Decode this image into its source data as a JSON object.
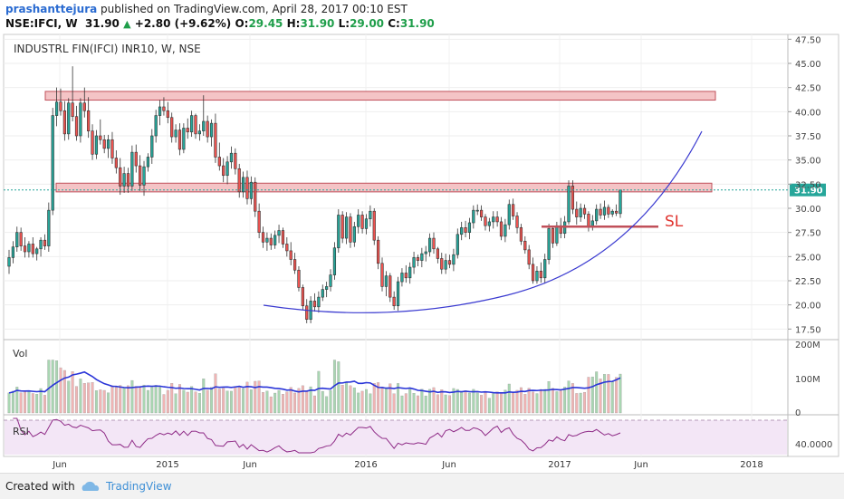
{
  "header": {
    "author": "prashanttejura",
    "published": " published on TradingView.com, April 28, 2017 00:10 EST",
    "symbol": "NSE:IFCI, W",
    "last": "31.90",
    "change": "+2.80 (+9.62%)",
    "o_label": "O:",
    "o_val": "29.45",
    "h_label": "H:",
    "h_val": "31.90",
    "l_label": "L:",
    "l_val": "29.00",
    "c_label": "C:",
    "c_val": "31.90"
  },
  "footer": {
    "created_with": "Created with",
    "brand": "TradingView"
  },
  "chart_data": {
    "type": "candlestick",
    "title": "INDUSTRL FIN(IFCI) INR10, W, NSE",
    "price_axis": {
      "range": [
        16.5,
        48.0
      ],
      "ticks": [
        "47.50",
        "45.00",
        "42.50",
        "40.00",
        "37.50",
        "35.00",
        "32.50",
        "30.00",
        "27.50",
        "25.00",
        "22.50",
        "20.00",
        "17.50"
      ]
    },
    "time_axis": {
      "ticks": [
        "Jun",
        "2015",
        "Jun",
        "2016",
        "Jun",
        "2017",
        "Jun",
        "2018"
      ]
    },
    "last_price_label": "31.90",
    "resistance_zones": [
      {
        "low": 41.2,
        "high": 42.1
      },
      {
        "low": 31.7,
        "high": 32.6
      }
    ],
    "stop_loss": {
      "price": 28.1,
      "label": "SL"
    },
    "rounding_bottom_curve": "cup pattern from Sep 2015 to Oct 2017",
    "volume_pane": {
      "label": "Vol",
      "ticks": [
        "200M",
        "100M",
        "0"
      ]
    },
    "rsi_pane": {
      "label": "RSI",
      "tick": "40.0000"
    },
    "colors": {
      "up": "#26a69a",
      "down": "#ef5350",
      "zone": "#f4c4c6",
      "curve": "#3a3ad0",
      "volume_ma": "#2a35d8",
      "rsi": "#8e2a86"
    },
    "candles_ohlc": [
      [
        24.0,
        25.7,
        23.2,
        24.9
      ],
      [
        24.9,
        26.6,
        24.3,
        26.0
      ],
      [
        26.0,
        28.1,
        25.5,
        27.5
      ],
      [
        27.5,
        28.0,
        25.6,
        26.1
      ],
      [
        26.1,
        27.0,
        24.9,
        25.5
      ],
      [
        25.5,
        26.6,
        24.9,
        26.3
      ],
      [
        26.3,
        27.0,
        24.9,
        25.3
      ],
      [
        25.3,
        26.0,
        24.6,
        25.8
      ],
      [
        25.8,
        27.0,
        25.0,
        26.7
      ],
      [
        26.7,
        27.3,
        25.7,
        26.1
      ],
      [
        26.1,
        30.6,
        25.5,
        29.8
      ],
      [
        29.8,
        40.4,
        29.3,
        39.6
      ],
      [
        39.6,
        42.5,
        38.5,
        41.0
      ],
      [
        41.0,
        42.4,
        39.6,
        40.1
      ],
      [
        40.1,
        41.1,
        37.0,
        37.7
      ],
      [
        37.7,
        41.4,
        37.1,
        40.9
      ],
      [
        40.9,
        44.7,
        39.0,
        39.5
      ],
      [
        39.5,
        40.6,
        37.0,
        37.5
      ],
      [
        37.5,
        41.4,
        36.8,
        40.9
      ],
      [
        40.9,
        42.5,
        39.4,
        40.1
      ],
      [
        40.1,
        41.5,
        37.3,
        38.0
      ],
      [
        38.0,
        38.7,
        35.0,
        35.6
      ],
      [
        35.6,
        38.1,
        35.1,
        37.5
      ],
      [
        37.5,
        39.2,
        36.6,
        37.1
      ],
      [
        37.1,
        37.6,
        35.7,
        36.2
      ],
      [
        36.2,
        37.6,
        35.2,
        37.1
      ],
      [
        37.1,
        37.9,
        34.6,
        35.2
      ],
      [
        35.2,
        36.0,
        33.6,
        34.2
      ],
      [
        34.2,
        35.2,
        31.4,
        32.3
      ],
      [
        32.3,
        34.3,
        31.6,
        33.6
      ],
      [
        33.6,
        34.2,
        31.6,
        32.3
      ],
      [
        32.3,
        36.5,
        31.8,
        35.8
      ],
      [
        35.8,
        36.6,
        33.7,
        34.4
      ],
      [
        34.4,
        35.5,
        31.8,
        32.4
      ],
      [
        32.4,
        34.9,
        31.3,
        34.3
      ],
      [
        34.3,
        35.7,
        33.8,
        35.3
      ],
      [
        35.3,
        38.2,
        34.6,
        37.5
      ],
      [
        37.5,
        40.2,
        36.8,
        39.6
      ],
      [
        39.6,
        41.2,
        38.6,
        40.5
      ],
      [
        40.5,
        41.5,
        39.6,
        40.1
      ],
      [
        40.1,
        41.0,
        38.8,
        39.4
      ],
      [
        39.4,
        39.9,
        36.8,
        37.4
      ],
      [
        37.4,
        38.7,
        36.8,
        38.1
      ],
      [
        38.1,
        38.8,
        35.5,
        36.1
      ],
      [
        36.1,
        38.8,
        35.7,
        38.3
      ],
      [
        38.3,
        39.3,
        37.2,
        37.9
      ],
      [
        37.9,
        40.1,
        37.4,
        39.6
      ],
      [
        39.6,
        39.8,
        37.2,
        37.7
      ],
      [
        37.7,
        38.7,
        37.0,
        38.0
      ],
      [
        38.0,
        41.7,
        37.5,
        39.0
      ],
      [
        39.0,
        39.6,
        36.8,
        37.4
      ],
      [
        37.4,
        39.2,
        36.4,
        38.8
      ],
      [
        38.8,
        39.8,
        34.7,
        35.3
      ],
      [
        35.3,
        36.8,
        33.9,
        34.4
      ],
      [
        34.4,
        35.2,
        32.7,
        33.4
      ],
      [
        33.4,
        35.4,
        32.5,
        34.8
      ],
      [
        34.8,
        36.4,
        34.1,
        35.7
      ],
      [
        35.7,
        36.2,
        33.5,
        34.1
      ],
      [
        34.1,
        34.6,
        31.1,
        31.7
      ],
      [
        31.7,
        33.8,
        31.1,
        33.2
      ],
      [
        33.2,
        33.9,
        30.4,
        31.0
      ],
      [
        31.0,
        33.3,
        30.4,
        32.7
      ],
      [
        32.7,
        33.2,
        29.1,
        29.7
      ],
      [
        29.7,
        30.5,
        26.9,
        27.5
      ],
      [
        27.5,
        28.1,
        25.9,
        26.5
      ],
      [
        26.5,
        27.5,
        25.6,
        26.9
      ],
      [
        26.9,
        27.4,
        25.7,
        26.2
      ],
      [
        26.2,
        27.7,
        25.8,
        27.2
      ],
      [
        27.2,
        28.3,
        26.4,
        27.7
      ],
      [
        27.7,
        28.0,
        25.9,
        26.3
      ],
      [
        26.3,
        27.0,
        25.0,
        25.6
      ],
      [
        25.6,
        26.5,
        24.1,
        24.7
      ],
      [
        24.7,
        25.4,
        23.2,
        23.6
      ],
      [
        23.6,
        24.0,
        21.4,
        21.8
      ],
      [
        21.8,
        22.1,
        19.5,
        19.9
      ],
      [
        19.9,
        20.6,
        18.1,
        18.5
      ],
      [
        18.5,
        20.9,
        18.1,
        20.4
      ],
      [
        20.4,
        21.2,
        19.3,
        19.8
      ],
      [
        19.8,
        21.4,
        19.2,
        20.8
      ],
      [
        20.8,
        22.1,
        20.4,
        21.6
      ],
      [
        21.6,
        22.4,
        20.8,
        21.9
      ],
      [
        21.9,
        23.7,
        21.4,
        23.1
      ],
      [
        23.1,
        26.5,
        22.6,
        25.9
      ],
      [
        25.9,
        29.9,
        25.4,
        29.3
      ],
      [
        29.3,
        29.7,
        26.4,
        26.9
      ],
      [
        26.9,
        29.6,
        26.3,
        29.1
      ],
      [
        29.1,
        29.5,
        25.9,
        26.5
      ],
      [
        26.5,
        28.6,
        26.0,
        28.1
      ],
      [
        28.1,
        29.9,
        27.4,
        29.3
      ],
      [
        29.3,
        29.7,
        27.4,
        27.9
      ],
      [
        27.9,
        29.4,
        27.3,
        28.9
      ],
      [
        28.9,
        30.3,
        28.1,
        29.7
      ],
      [
        29.7,
        30.0,
        26.2,
        26.7
      ],
      [
        26.7,
        27.1,
        23.7,
        24.3
      ],
      [
        24.3,
        24.9,
        21.4,
        21.9
      ],
      [
        21.9,
        23.5,
        20.9,
        23.0
      ],
      [
        23.0,
        23.3,
        20.3,
        20.8
      ],
      [
        20.8,
        21.4,
        19.5,
        19.9
      ],
      [
        19.9,
        22.9,
        19.4,
        22.4
      ],
      [
        22.4,
        23.8,
        21.9,
        23.3
      ],
      [
        23.3,
        24.1,
        22.3,
        22.8
      ],
      [
        22.8,
        24.4,
        22.2,
        23.9
      ],
      [
        23.9,
        25.5,
        23.2,
        24.9
      ],
      [
        24.9,
        25.2,
        24.0,
        24.6
      ],
      [
        24.6,
        25.9,
        23.9,
        25.3
      ],
      [
        25.3,
        26.1,
        24.5,
        25.5
      ],
      [
        25.5,
        27.4,
        25.0,
        26.9
      ],
      [
        26.9,
        27.5,
        25.3,
        25.8
      ],
      [
        25.8,
        26.0,
        24.3,
        24.8
      ],
      [
        24.8,
        25.4,
        23.2,
        23.7
      ],
      [
        23.7,
        25.3,
        23.2,
        24.6
      ],
      [
        24.6,
        25.2,
        23.8,
        24.2
      ],
      [
        24.2,
        25.8,
        23.5,
        25.2
      ],
      [
        25.2,
        27.9,
        24.8,
        27.3
      ],
      [
        27.3,
        28.6,
        26.7,
        28.0
      ],
      [
        28.0,
        28.7,
        27.0,
        27.5
      ],
      [
        27.5,
        29.0,
        26.8,
        28.5
      ],
      [
        28.5,
        30.3,
        27.9,
        29.8
      ],
      [
        29.8,
        30.4,
        29.3,
        29.8
      ],
      [
        29.8,
        30.3,
        28.7,
        29.1
      ],
      [
        29.1,
        29.4,
        27.7,
        28.2
      ],
      [
        28.2,
        29.0,
        27.6,
        28.6
      ],
      [
        28.6,
        29.7,
        27.9,
        29.1
      ],
      [
        29.1,
        29.7,
        28.1,
        28.6
      ],
      [
        28.6,
        29.1,
        26.7,
        27.1
      ],
      [
        27.1,
        28.9,
        26.5,
        28.3
      ],
      [
        28.3,
        30.9,
        27.8,
        30.4
      ],
      [
        30.4,
        31.0,
        28.8,
        29.2
      ],
      [
        29.2,
        29.6,
        27.4,
        28.0
      ],
      [
        28.0,
        28.4,
        26.2,
        26.6
      ],
      [
        26.6,
        27.1,
        25.3,
        25.7
      ],
      [
        25.7,
        26.2,
        23.7,
        24.2
      ],
      [
        24.2,
        24.9,
        22.2,
        22.5
      ],
      [
        22.5,
        24.0,
        22.2,
        23.5
      ],
      [
        23.5,
        24.4,
        22.3,
        22.8
      ],
      [
        22.8,
        25.3,
        22.2,
        24.7
      ],
      [
        24.7,
        28.4,
        24.2,
        27.9
      ],
      [
        27.9,
        28.1,
        25.9,
        26.4
      ],
      [
        26.4,
        28.6,
        26.1,
        28.2
      ],
      [
        28.2,
        29.0,
        26.9,
        27.4
      ],
      [
        27.4,
        29.2,
        26.9,
        28.6
      ],
      [
        28.6,
        32.9,
        28.3,
        32.3
      ],
      [
        32.3,
        32.9,
        29.4,
        29.9
      ],
      [
        29.9,
        30.7,
        28.3,
        29.1
      ],
      [
        29.1,
        30.5,
        28.6,
        30.0
      ],
      [
        30.0,
        30.4,
        28.9,
        29.4
      ],
      [
        29.4,
        29.7,
        27.6,
        28.1
      ],
      [
        28.1,
        29.3,
        27.7,
        28.7
      ],
      [
        28.7,
        30.4,
        28.3,
        29.9
      ],
      [
        29.9,
        30.5,
        28.9,
        29.3
      ],
      [
        29.3,
        30.8,
        28.8,
        30.1
      ],
      [
        30.1,
        30.4,
        29.0,
        29.4
      ],
      [
        29.4,
        29.9,
        29.1,
        29.7
      ],
      [
        29.7,
        30.4,
        29.2,
        29.5
      ],
      [
        29.45,
        31.9,
        29.0,
        31.9
      ]
    ]
  }
}
